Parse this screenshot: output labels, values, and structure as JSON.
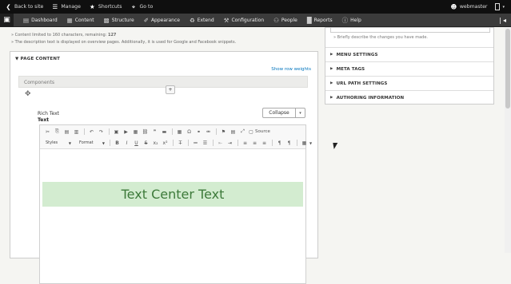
{
  "toolbar_top": {
    "back": "Back to site",
    "manage": "Manage",
    "shortcuts": "Shortcuts",
    "goto": "Go to",
    "user": "webmaster"
  },
  "admin_menu": {
    "items": [
      "Dashboard",
      "Content",
      "Structure",
      "Appearance",
      "Extend",
      "Configuration",
      "People",
      "Reports",
      "Help"
    ]
  },
  "form": {
    "hint_limit": "Content limited to 160 characters, remaining:",
    "hint_remaining": "127",
    "hint_desc": "The description text is displayed on overview pages. Additionally, it is used for Google and Facebook snippets.",
    "page_content": "PAGE CONTENT",
    "show_row_weights": "Show row weights",
    "components": "Components",
    "add_button": "+",
    "rich_text_label": "Rich Text",
    "text_label": "Text",
    "collapse": "Collapse",
    "styles": "Styles",
    "format": "Format",
    "source": "Source",
    "banner_text": "Text Center Text"
  },
  "sidebar": {
    "revision_hint": "Briefly describe the changes you have made.",
    "sections": [
      "MENU SETTINGS",
      "META TAGS",
      "URL PATH SETTINGS",
      "AUTHORING INFORMATION"
    ]
  }
}
